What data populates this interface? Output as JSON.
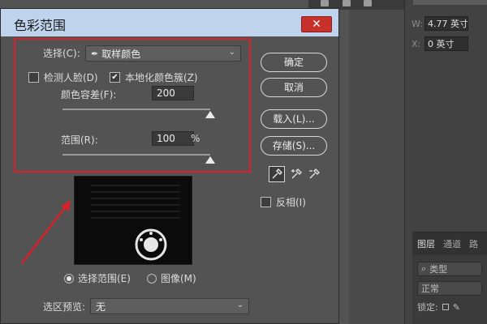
{
  "dialog": {
    "title": "色彩范围",
    "close_glyph": "✕"
  },
  "select_row": {
    "label": "选择(C):",
    "value": "取样颜色",
    "icon": "eyedropper-icon"
  },
  "options": {
    "detect_faces": "检测人脸(D)",
    "detect_faces_checked": false,
    "localized_clusters": "本地化颜色簇(Z)",
    "localized_clusters_checked": true
  },
  "fuzziness": {
    "label": "颜色容差(F):",
    "value": "200",
    "slider_fraction": 1.0
  },
  "range": {
    "label": "范围(R):",
    "value": "100",
    "unit": "%",
    "slider_fraction": 1.0
  },
  "buttons": {
    "ok": "确定",
    "cancel": "取消",
    "load": "载入(L)...",
    "save": "存储(S)..."
  },
  "invert": {
    "label": "反相(I)",
    "checked": false
  },
  "view_mode": {
    "selection": "选择范围(E)",
    "image": "图像(M)",
    "selected": "selection"
  },
  "selection_preview": {
    "label": "选区预览:",
    "value": "无"
  },
  "properties_panel": {
    "w_label": "W:",
    "w_value": "4.77 英寸",
    "x_label": "X:",
    "x_value": "0 英寸"
  },
  "layers_panel": {
    "tab_layers": "图层",
    "tab_channels": "通道",
    "tab_paths": "路",
    "kind": "类型",
    "blend": "正常",
    "lock": "锁定:"
  },
  "colors": {
    "highlight_red": "#d8212b",
    "close_red": "#c8302c",
    "titlebar": "#bfd4ec",
    "dialog_bg": "#535353"
  }
}
